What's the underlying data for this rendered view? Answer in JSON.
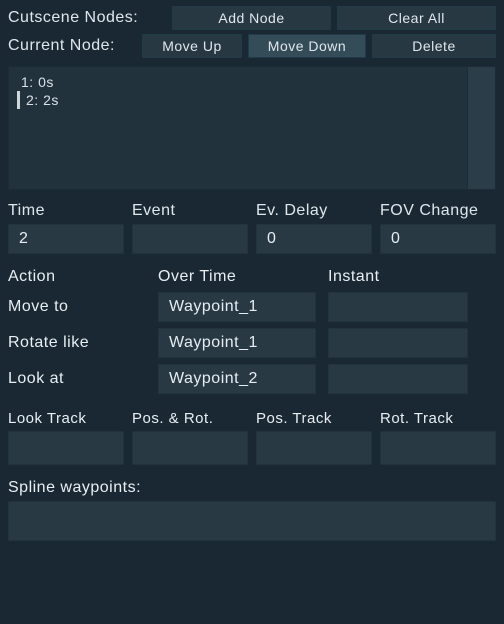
{
  "header": {
    "nodes_label": "Cutscene Nodes:",
    "add_node": "Add Node",
    "clear_all": "Clear All",
    "current_label": "Current Node:",
    "move_up": "Move Up",
    "move_down": "Move Down",
    "delete": "Delete"
  },
  "nodes": {
    "items": [
      {
        "label": "1: 0s",
        "selected": false
      },
      {
        "label": "2: 2s",
        "selected": true
      }
    ]
  },
  "fields": {
    "time": {
      "label": "Time",
      "value": "2"
    },
    "event": {
      "label": "Event",
      "value": ""
    },
    "ev_delay": {
      "label": "Ev. Delay",
      "value": "0"
    },
    "fov_change": {
      "label": "FOV Change",
      "value": "0"
    }
  },
  "action_grid": {
    "head_action": "Action",
    "head_over_time": "Over Time",
    "head_instant": "Instant",
    "rows": [
      {
        "label": "Move to",
        "over_time": "Waypoint_1",
        "instant": ""
      },
      {
        "label": "Rotate like",
        "over_time": "Waypoint_1",
        "instant": ""
      },
      {
        "label": "Look at",
        "over_time": "Waypoint_2",
        "instant": ""
      }
    ]
  },
  "tracks": {
    "look": "Look Track",
    "posrot": "Pos. & Rot.",
    "pos": "Pos. Track",
    "rot": "Rot. Track"
  },
  "spline": {
    "label": "Spline waypoints:"
  }
}
